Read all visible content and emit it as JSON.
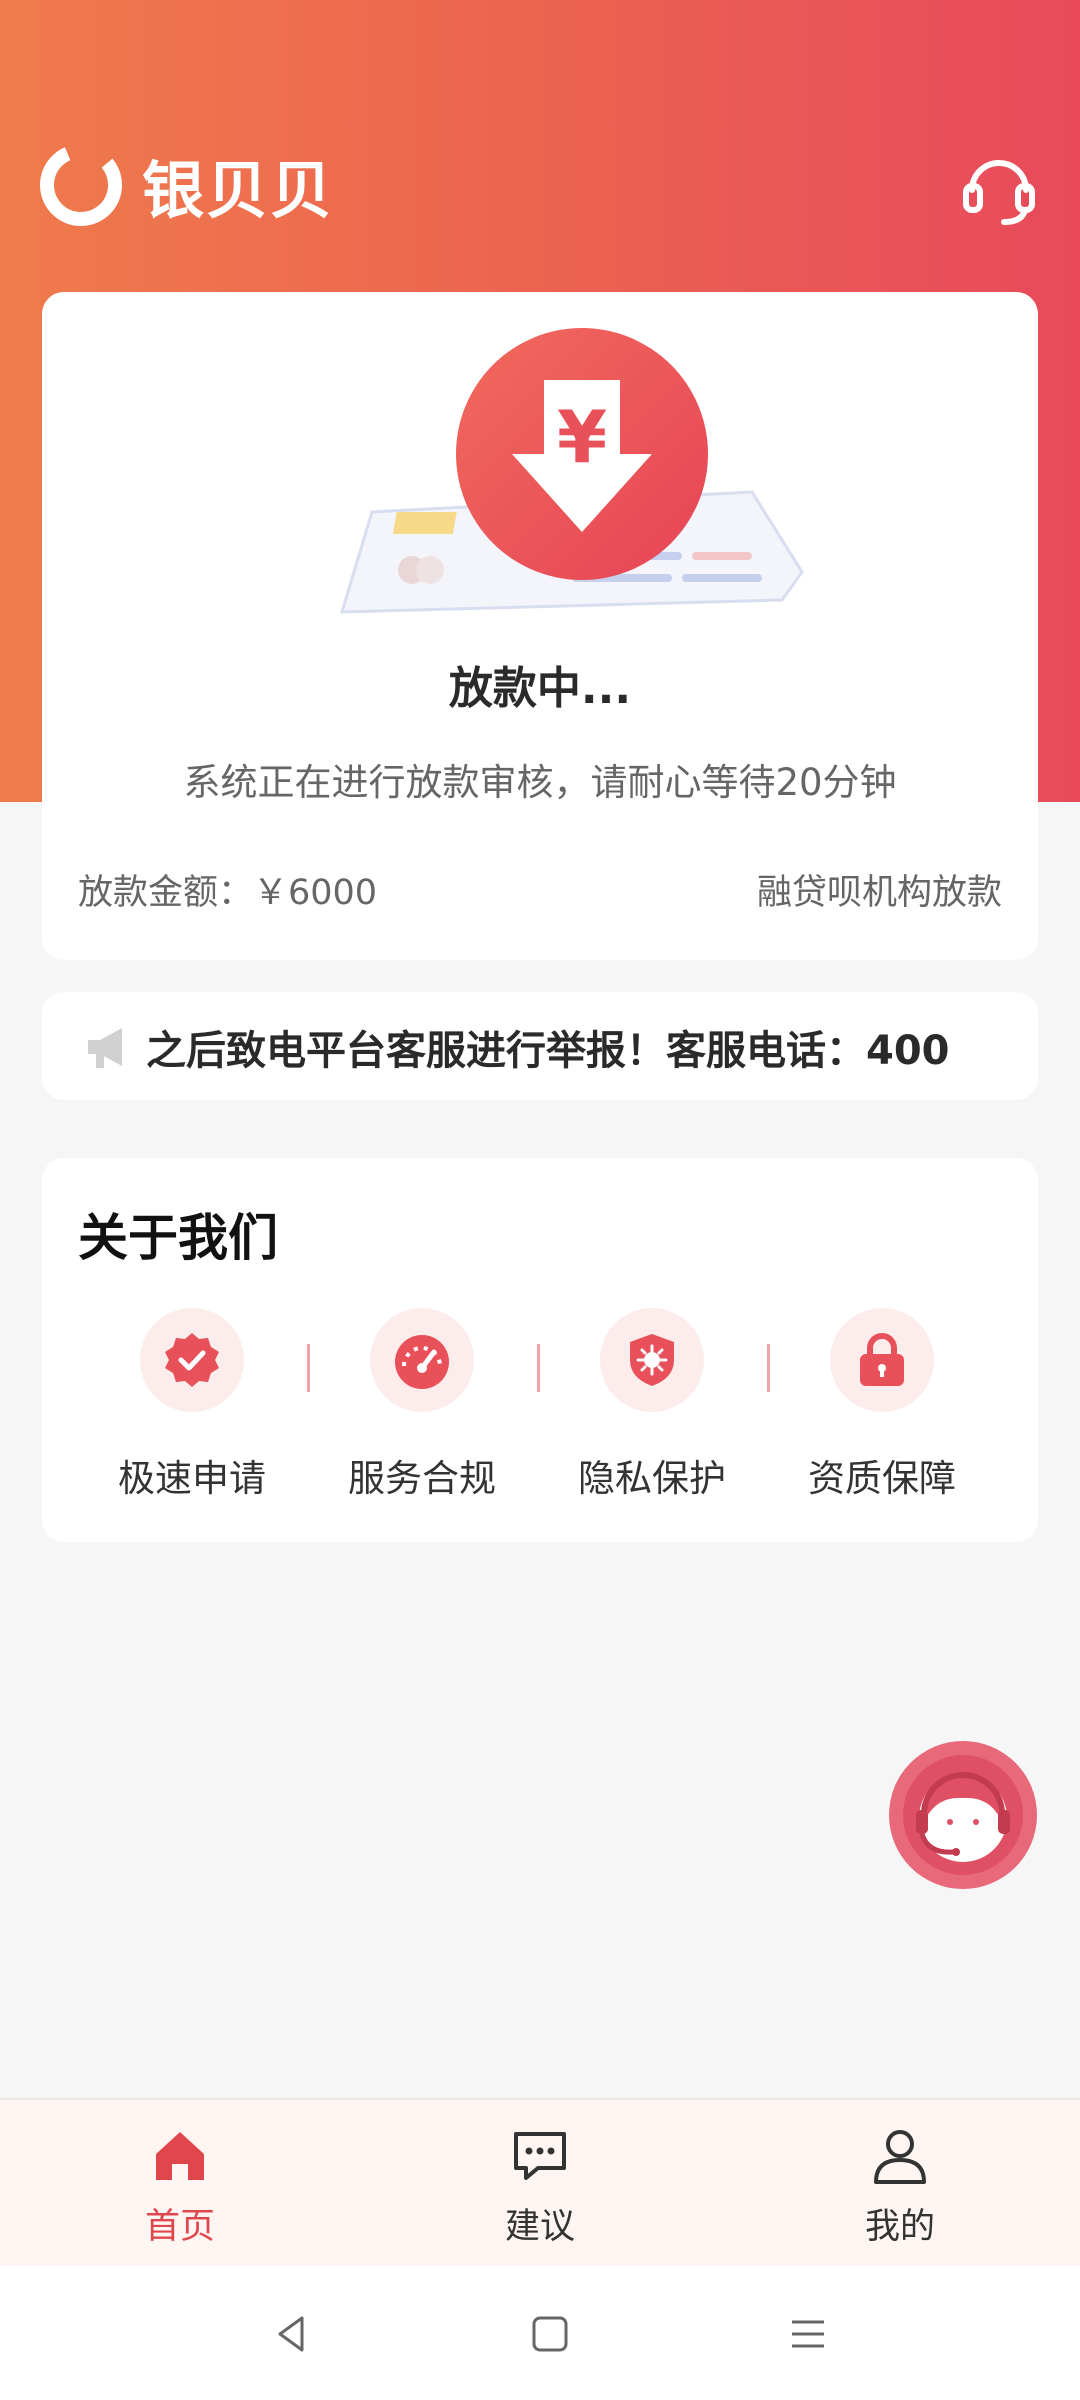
{
  "brand": {
    "name": "银贝贝",
    "logo_icon": "brand-logo-icon"
  },
  "header": {
    "support_icon": "headset-icon"
  },
  "status_card": {
    "title": "放款中...",
    "description": "系统正在进行放款审核，请耐心等待20分钟",
    "amount_label": "放款金额：￥6000",
    "institution": "融贷呗机构放款"
  },
  "notice": {
    "icon": "megaphone-icon",
    "text": "之后致电平台客服进行举报！客服电话：400"
  },
  "about": {
    "title": "关于我们",
    "features": [
      {
        "label": "极速申请",
        "icon": "badge-check-icon"
      },
      {
        "label": "服务合规",
        "icon": "speedometer-icon"
      },
      {
        "label": "隐私保护",
        "icon": "shield-virus-icon"
      },
      {
        "label": "资质保障",
        "icon": "lock-icon"
      }
    ]
  },
  "tabbar": {
    "tabs": [
      {
        "label": "首页",
        "icon": "home-icon",
        "active": true
      },
      {
        "label": "建议",
        "icon": "message-dots-icon",
        "active": false
      },
      {
        "label": "我的",
        "icon": "user-icon",
        "active": false
      }
    ]
  },
  "colors": {
    "accent": "#e84a5c",
    "gradient_start": "#ef7b4c",
    "gradient_end": "#e84a5c",
    "active_tab": "#e0474d"
  }
}
